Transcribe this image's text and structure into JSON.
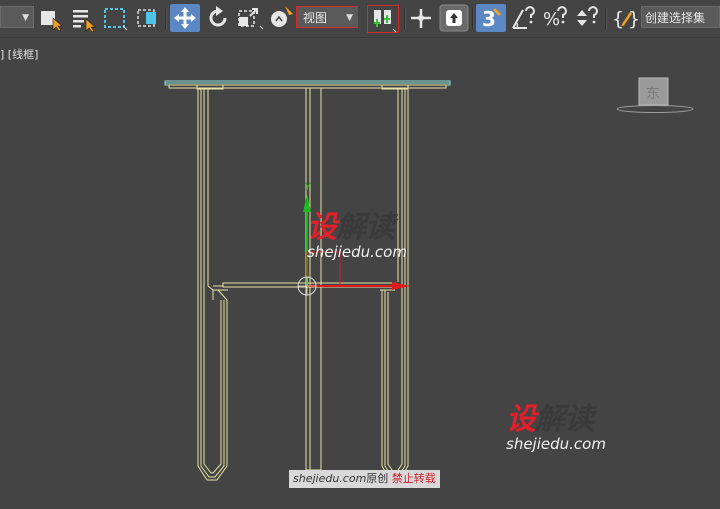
{
  "toolbar": {
    "view_dropdown": "视图",
    "snap_angle_label": "3",
    "named_selection_label": "创建选择集"
  },
  "viewport": {
    "label_prefix": "]",
    "label_mode": "[线框]",
    "label_suffix": "]",
    "gizmo_y_axis": "y",
    "navcube_face": "东"
  },
  "watermark": {
    "logo_red": "设",
    "logo_dark": "解读",
    "site": "shejiedu.com",
    "banner_site": "shejiedu.com",
    "banner_original": "原创",
    "banner_warning": "禁止转载"
  },
  "colors": {
    "background": "#444444",
    "wireframe": "#e8e4a4",
    "axis_x": "#e01a1a",
    "axis_y": "#1fb81f",
    "logo_red": "#e0202a",
    "active_button": "#5b87c5"
  }
}
